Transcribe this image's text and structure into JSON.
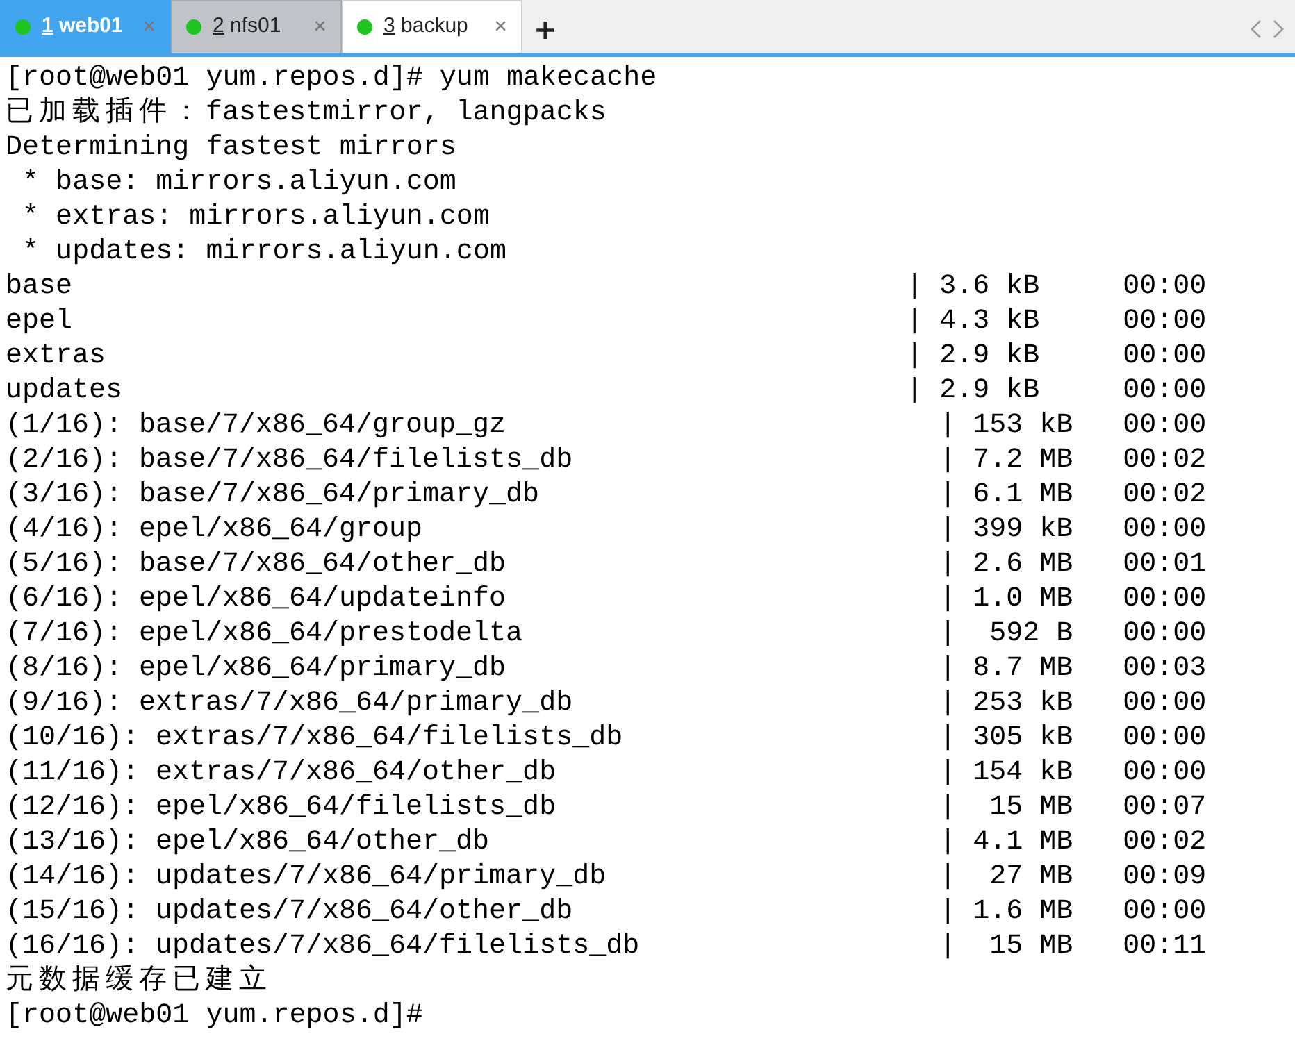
{
  "tabs": [
    {
      "number": "1",
      "label": "web01",
      "close": "×",
      "color": "#1ec51e",
      "highlighted": true,
      "selected": false
    },
    {
      "number": "2",
      "label": "nfs01",
      "close": "×",
      "color": "#1ec51e",
      "highlighted": false,
      "selected": false
    },
    {
      "number": "3",
      "label": "backup",
      "close": "×",
      "color": "#1ec51e",
      "highlighted": false,
      "selected": true
    }
  ],
  "new_tab": "+",
  "terminal": {
    "lines": [
      {
        "kind": "text",
        "text": "[root@web01 yum.repos.d]# yum makecache"
      },
      {
        "kind": "text",
        "text": "已加载插件：fastestmirror, langpacks"
      },
      {
        "kind": "text",
        "text": "Determining fastest mirrors"
      },
      {
        "kind": "text",
        "text": " * base: mirrors.aliyun.com"
      },
      {
        "kind": "text",
        "text": " * extras: mirrors.aliyun.com"
      },
      {
        "kind": "text",
        "text": " * updates: mirrors.aliyun.com"
      },
      {
        "kind": "repo",
        "name": "base",
        "separator": "|",
        "size": "3.6 kB",
        "time": "00:00"
      },
      {
        "kind": "repo",
        "name": "epel",
        "separator": "|",
        "size": "4.3 kB",
        "time": "00:00"
      },
      {
        "kind": "repo",
        "name": "extras",
        "separator": "|",
        "size": "2.9 kB",
        "time": "00:00"
      },
      {
        "kind": "repo",
        "name": "updates",
        "separator": "|",
        "size": "2.9 kB",
        "time": "00:00"
      },
      {
        "kind": "file",
        "name": "(1/16): base/7/x86_64/group_gz",
        "separator": "|",
        "size": "153 kB",
        "time": "00:00"
      },
      {
        "kind": "file",
        "name": "(2/16): base/7/x86_64/filelists_db",
        "separator": "|",
        "size": "7.2 MB",
        "time": "00:02"
      },
      {
        "kind": "file",
        "name": "(3/16): base/7/x86_64/primary_db",
        "separator": "|",
        "size": "6.1 MB",
        "time": "00:02"
      },
      {
        "kind": "file",
        "name": "(4/16): epel/x86_64/group",
        "separator": "|",
        "size": "399 kB",
        "time": "00:00"
      },
      {
        "kind": "file",
        "name": "(5/16): base/7/x86_64/other_db",
        "separator": "|",
        "size": "2.6 MB",
        "time": "00:01"
      },
      {
        "kind": "file",
        "name": "(6/16): epel/x86_64/updateinfo",
        "separator": "|",
        "size": "1.0 MB",
        "time": "00:00"
      },
      {
        "kind": "file",
        "name": "(7/16): epel/x86_64/prestodelta",
        "separator": "|",
        "size": "592 B",
        "time": "00:00"
      },
      {
        "kind": "file",
        "name": "(8/16): epel/x86_64/primary_db",
        "separator": "|",
        "size": "8.7 MB",
        "time": "00:03"
      },
      {
        "kind": "file",
        "name": "(9/16): extras/7/x86_64/primary_db",
        "separator": "|",
        "size": "253 kB",
        "time": "00:00"
      },
      {
        "kind": "file",
        "name": "(10/16): extras/7/x86_64/filelists_db",
        "separator": "|",
        "size": "305 kB",
        "time": "00:00"
      },
      {
        "kind": "file",
        "name": "(11/16): extras/7/x86_64/other_db",
        "separator": "|",
        "size": "154 kB",
        "time": "00:00"
      },
      {
        "kind": "file",
        "name": "(12/16): epel/x86_64/filelists_db",
        "separator": "|",
        "size": "15 MB",
        "time": "00:07"
      },
      {
        "kind": "file",
        "name": "(13/16): epel/x86_64/other_db",
        "separator": "|",
        "size": "4.1 MB",
        "time": "00:02"
      },
      {
        "kind": "file",
        "name": "(14/16): updates/7/x86_64/primary_db",
        "separator": "|",
        "size": "27 MB",
        "time": "00:09"
      },
      {
        "kind": "file",
        "name": "(15/16): updates/7/x86_64/other_db",
        "separator": "|",
        "size": "1.6 MB",
        "time": "00:00"
      },
      {
        "kind": "file",
        "name": "(16/16): updates/7/x86_64/filelists_db",
        "separator": "|",
        "size": "15 MB",
        "time": "00:11"
      },
      {
        "kind": "text",
        "text": "元数据缓存已建立"
      },
      {
        "kind": "text",
        "text": "[root@web01 yum.repos.d]#"
      }
    ]
  }
}
